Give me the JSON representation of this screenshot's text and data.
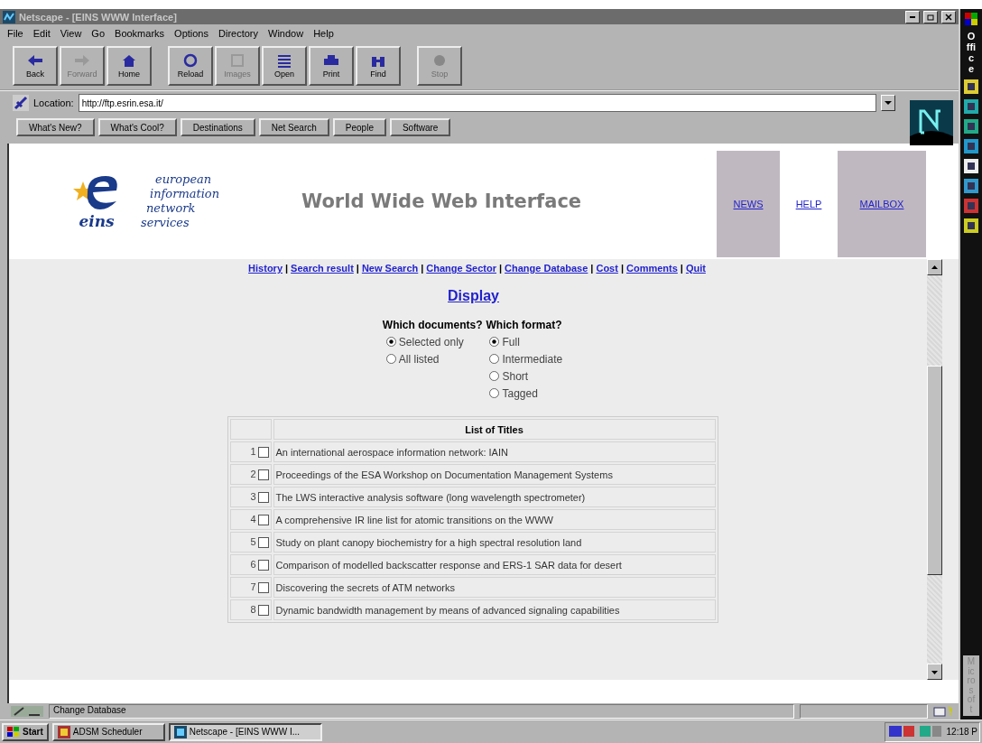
{
  "window": {
    "title": "Netscape - [EINS WWW Interface]"
  },
  "menu": [
    "File",
    "Edit",
    "View",
    "Go",
    "Bookmarks",
    "Options",
    "Directory",
    "Window",
    "Help"
  ],
  "toolbar": [
    {
      "label": "Back",
      "disabled": false
    },
    {
      "label": "Forward",
      "disabled": true
    },
    {
      "label": "Home",
      "disabled": false
    },
    {
      "label": "Reload",
      "disabled": false
    },
    {
      "label": "Images",
      "disabled": true
    },
    {
      "label": "Open",
      "disabled": false
    },
    {
      "label": "Print",
      "disabled": false
    },
    {
      "label": "Find",
      "disabled": false
    },
    {
      "label": "Stop",
      "disabled": true
    }
  ],
  "location": {
    "label": "Location:",
    "value": "http://ftp.esrin.esa.it/"
  },
  "directory_buttons": [
    "What's New?",
    "What's Cool?",
    "Destinations",
    "Net Search",
    "People",
    "Software"
  ],
  "header": {
    "logo_letters": "eins",
    "logo_lines": [
      "european",
      "information",
      "network",
      "services"
    ],
    "title": "World Wide Web Interface",
    "links": [
      {
        "label": "NEWS",
        "shaded": true
      },
      {
        "label": "HELP",
        "shaded": false
      },
      {
        "label": "MAILBOX",
        "shaded": true
      }
    ]
  },
  "nav_links": [
    "History",
    "Search result",
    "New Search",
    "Change Sector",
    "Change Database",
    "Cost",
    "Comments",
    "Quit"
  ],
  "nav_separators": [
    "|",
    "|",
    "|",
    "|",
    "|",
    "|",
    "|"
  ],
  "display_link": "Display",
  "documents": {
    "heading": "Which documents?",
    "options": [
      {
        "label": "Selected only",
        "selected": true
      },
      {
        "label": "All listed",
        "selected": false
      }
    ]
  },
  "format": {
    "heading": "Which format?",
    "options": [
      {
        "label": "Full",
        "selected": true
      },
      {
        "label": "Intermediate",
        "selected": false
      },
      {
        "label": "Short",
        "selected": false
      },
      {
        "label": "Tagged",
        "selected": false
      }
    ]
  },
  "table": {
    "header": "List of Titles",
    "rows": [
      {
        "number": "1",
        "checked": false,
        "title": "An international aerospace information network: IAIN"
      },
      {
        "number": "2",
        "checked": false,
        "title": "Proceedings of the ESA Workshop on Documentation Management Systems"
      },
      {
        "number": "3",
        "checked": false,
        "title": "The LWS interactive analysis software (long wavelength spectrometer)"
      },
      {
        "number": "4",
        "checked": false,
        "title": "A comprehensive IR line list for atomic transitions on the WWW"
      },
      {
        "number": "5",
        "checked": false,
        "title": "Study on plant canopy biochemistry for a high spectral resolution land"
      },
      {
        "number": "6",
        "checked": false,
        "title": "Comparison of modelled backscatter response and ERS-1 SAR data for desert"
      },
      {
        "number": "7",
        "checked": false,
        "title": "Discovering the secrets of ATM networks"
      },
      {
        "number": "8",
        "checked": false,
        "title": "Dynamic bandwidth management by means of advanced signaling capabilities"
      }
    ]
  },
  "status_bar": {
    "text": "Change Database"
  },
  "taskbar": {
    "start": "Start",
    "tasks": [
      {
        "label": "ADSM Scheduler",
        "selected": false
      },
      {
        "label": "Netscape - [EINS WWW I...",
        "selected": true
      }
    ],
    "clock": "12:18 P"
  },
  "office_bar": {
    "top": "Office",
    "bottom": "Microsoft"
  }
}
